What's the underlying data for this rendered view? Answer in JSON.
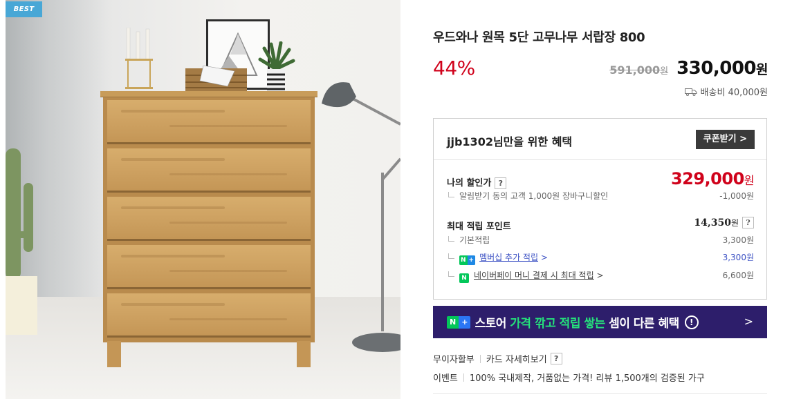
{
  "image": {
    "badge": "BEST"
  },
  "product": {
    "title": "우드와나 원목 5단 고무나무 서랍장 800",
    "discount_rate": "44%",
    "original_price": "591,000",
    "original_unit": "원",
    "final_price": "330,000",
    "final_unit": "원",
    "shipping": "배송비 40,000원"
  },
  "benefit": {
    "title": "jjb1302님만을 위한 혜택",
    "coupon_button": "쿠폰받기 >",
    "my_price_label": "나의 할인가",
    "my_price": "329,000",
    "my_price_unit": "원",
    "my_price_detail": "알림받기 동의 고객 1,000원 장바구니할인",
    "my_price_detail_value": "-1,000원",
    "points_label": "최대 적립 포인트",
    "points_total": "14,350",
    "points_unit": "원",
    "points_rows": [
      {
        "label": "기본적립",
        "value": "3,300원"
      },
      {
        "label": "멤버십 추가 적립",
        "value": "3,300원",
        "badge_n": "N",
        "badge_plus": "+"
      },
      {
        "label": "네이버페이 머니 결제 시 최대 적립",
        "value": "6,600원",
        "badge": "N"
      }
    ],
    "help_glyph": "?",
    "link_arrow": ">"
  },
  "store_banner": {
    "badge_n": "N",
    "badge_plus": "+",
    "text_pre": "스토어 ",
    "text_highlight": "가격 깎고 적립 쌓는",
    "text_post": " 셈이 다른 혜택",
    "info_glyph": "!",
    "arrow": ">"
  },
  "meta": {
    "installment_label": "무이자할부",
    "card_link": "카드 자세히보기",
    "event_label": "이벤트",
    "event_text": "100% 국내제작, 거품없는 가격! 리뷰 1,500개의 검증된 가구"
  },
  "colors": {
    "discount_red": "#d0021b",
    "badge_blue": "#48a7d6",
    "banner_purple": "#2d1e6b",
    "naver_green": "#03c75a",
    "link_blue": "#3d52c4"
  }
}
